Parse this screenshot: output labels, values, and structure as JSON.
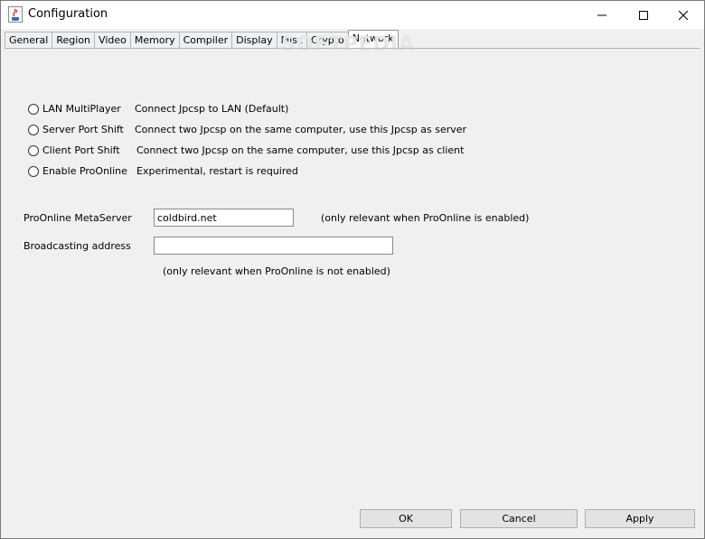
{
  "window": {
    "title": "Configuration",
    "icon": "java-cup-icon"
  },
  "tabs": [
    {
      "label": "General"
    },
    {
      "label": "Region"
    },
    {
      "label": "Video"
    },
    {
      "label": "Memory"
    },
    {
      "label": "Compiler"
    },
    {
      "label": "Display"
    },
    {
      "label": "Misc"
    },
    {
      "label": "Crypto"
    },
    {
      "label": "Network",
      "active": true
    }
  ],
  "watermark": "SOFTPEDIA",
  "network": {
    "modes": [
      {
        "label": "LAN MultiPlayer",
        "description": "Connect Jpcsp to LAN (Default)",
        "selected": false
      },
      {
        "label": "Server Port Shift",
        "description": "Connect two Jpcsp on the same computer, use this Jpcsp as server",
        "selected": false
      },
      {
        "label": "Client Port Shift",
        "description": "Connect two Jpcsp on the same computer, use this Jpcsp as client",
        "selected": false
      },
      {
        "label": "Enable ProOnline",
        "description": "Experimental, restart is required",
        "selected": false
      }
    ],
    "metaserver": {
      "label": "ProOnline MetaServer",
      "value": "coldbird.net",
      "hint": "(only relevant when ProOnline is enabled)"
    },
    "broadcast": {
      "label": "Broadcasting address",
      "value": "",
      "hint": "(only relevant when ProOnline is not enabled)"
    }
  },
  "buttons": {
    "ok": "OK",
    "cancel": "Cancel",
    "apply": "Apply"
  }
}
